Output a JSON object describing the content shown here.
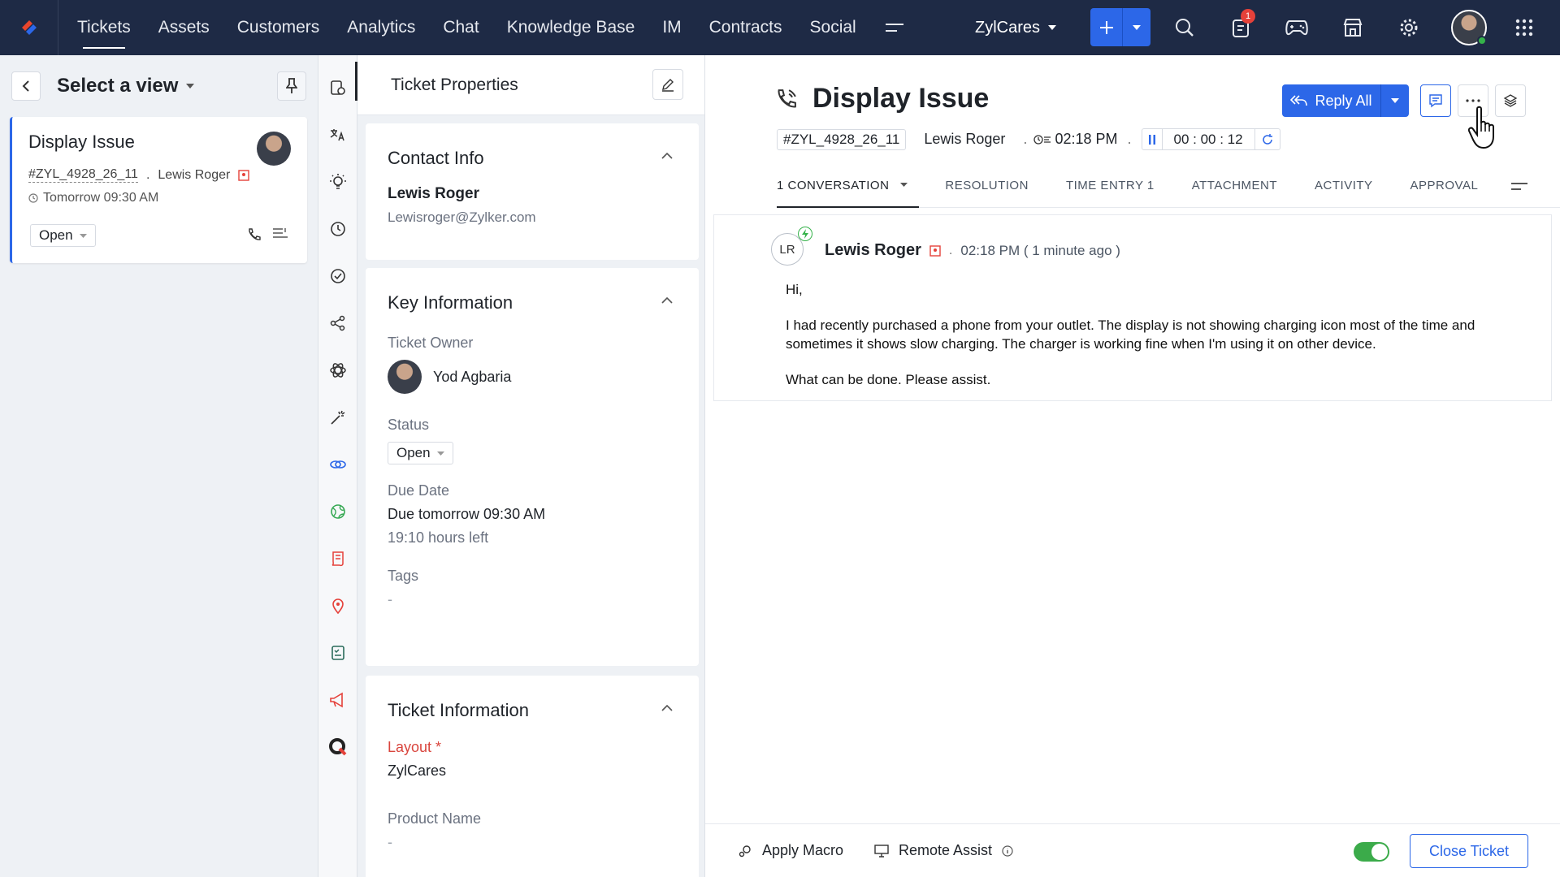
{
  "nav": {
    "items": [
      "Tickets",
      "Assets",
      "Customers",
      "Analytics",
      "Chat",
      "Knowledge Base",
      "IM",
      "Contracts",
      "Social"
    ],
    "active": "Tickets",
    "department": "ZylCares",
    "notification_count": "1"
  },
  "list": {
    "view_title": "Select a view",
    "ticket": {
      "title": "Display Issue",
      "id": "#ZYL_4928_26_11",
      "contact": "Lewis Roger",
      "due": "Tomorrow 09:30 AM",
      "status": "Open"
    }
  },
  "props": {
    "header": "Ticket Properties",
    "contact": {
      "title": "Contact Info",
      "name": "Lewis Roger",
      "email": "Lewisroger@Zylker.com"
    },
    "key_info": {
      "title": "Key Information",
      "owner_label": "Ticket Owner",
      "owner": "Yod Agbaria",
      "status_label": "Status",
      "status": "Open",
      "due_label": "Due Date",
      "due": "Due tomorrow 09:30 AM",
      "due_left": "19:10 hours left",
      "tags_label": "Tags",
      "tags": "-"
    },
    "ticket_info": {
      "title": "Ticket Information",
      "layout_label": "Layout *",
      "layout": "ZylCares",
      "product_label": "Product Name",
      "product": "-"
    }
  },
  "detail": {
    "title": "Display Issue",
    "id": "#ZYL_4928_26_11",
    "contact": "Lewis Roger",
    "time": "02:18 PM",
    "timer": "00 : 00 : 12",
    "reply_label": "Reply All",
    "tabs": [
      "1 CONVERSATION",
      "RESOLUTION",
      "TIME ENTRY 1",
      "ATTACHMENT",
      "ACTIVITY",
      "APPROVAL"
    ],
    "thread": {
      "initials": "LR",
      "author": "Lewis Roger",
      "when": "02:18 PM ( 1 minute ago )",
      "greeting": "Hi,",
      "body": "I had recently purchased a phone from your outlet. The display is not showing charging icon most of the time and sometimes it shows slow charging. The charger is working fine when I'm using it on other device.",
      "closing": "What can be done. Please assist."
    },
    "bottom": {
      "apply_macro": "Apply Macro",
      "remote_assist": "Remote Assist",
      "close_ticket": "Close Ticket"
    }
  },
  "colors": {
    "topbar": "#1e2a45",
    "accent": "#2c67e8",
    "toggle_on": "#3bab4a",
    "required": "#d9453d"
  }
}
